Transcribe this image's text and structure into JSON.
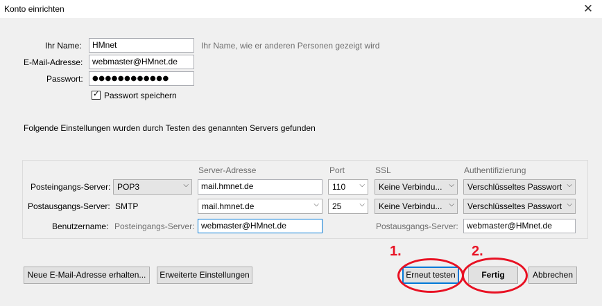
{
  "window": {
    "title": "Konto einrichten"
  },
  "form": {
    "name_label": "Ihr Name:",
    "name_value": "HMnet",
    "name_hint": "Ihr Name, wie er anderen Personen gezeigt wird",
    "email_label": "E-Mail-Adresse:",
    "email_value": "webmaster@HMnet.de",
    "password_label": "Passwort:",
    "password_value": "●●●●●●●●●●●●",
    "remember_label": "Passwort speichern",
    "remember_checked": true
  },
  "message": "Folgende Einstellungen wurden durch Testen des genannten Servers gefunden",
  "servers": {
    "headers": {
      "server_address": "Server-Adresse",
      "port": "Port",
      "ssl": "SSL",
      "auth": "Authentifizierung"
    },
    "incoming": {
      "label": "Posteingangs-Server:",
      "protocol": "POP3",
      "address": "mail.hmnet.de",
      "port": "110",
      "ssl": "Keine Verbindu...",
      "auth": "Verschlüsseltes Passwort"
    },
    "outgoing": {
      "label": "Postausgangs-Server:",
      "protocol": "SMTP",
      "address": "mail.hmnet.de",
      "port": "25",
      "ssl": "Keine Verbindu...",
      "auth": "Verschlüsseltes Passwort"
    },
    "username": {
      "label": "Benutzername:",
      "incoming_label": "Posteingangs-Server:",
      "incoming_value": "webmaster@HMnet.de",
      "outgoing_label": "Postausgangs-Server:",
      "outgoing_value": "webmaster@HMnet.de"
    }
  },
  "buttons": {
    "new_address": "Neue E-Mail-Adresse erhalten...",
    "advanced": "Erweiterte Einstellungen",
    "retest": "Erneut testen",
    "done": "Fertig",
    "cancel": "Abbrechen"
  },
  "annotations": {
    "step1": "1.",
    "step2": "2.",
    "color": "#e81123"
  },
  "icons": {
    "close": "close-icon",
    "dropdown": "chevron-down-icon",
    "check": "check-icon"
  }
}
